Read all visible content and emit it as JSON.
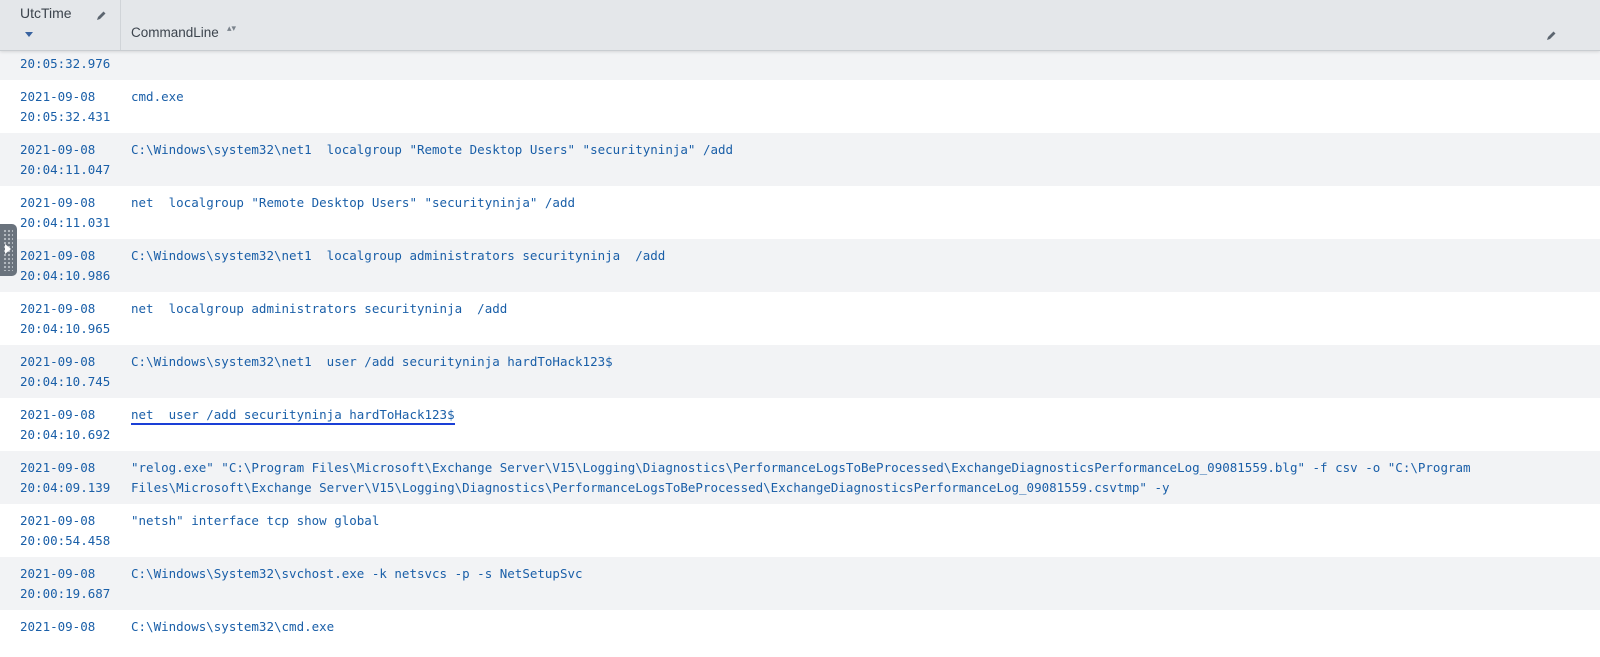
{
  "header": {
    "utc_title": "UtcTime",
    "cmd_title": "CommandLine",
    "sort_both_glyph": "▴▾"
  },
  "rows": [
    {
      "date": "",
      "time": "20:05:32.976",
      "cmd": "",
      "cmd2": ""
    },
    {
      "date": "2021-09-08",
      "time": "20:05:32.431",
      "cmd": "cmd.exe",
      "cmd2": ""
    },
    {
      "date": "2021-09-08",
      "time": "20:04:11.047",
      "cmd": "C:\\Windows\\system32\\net1  localgroup \"Remote Desktop Users\" \"securityninja\" /add",
      "cmd2": ""
    },
    {
      "date": "2021-09-08",
      "time": "20:04:11.031",
      "cmd": "net  localgroup \"Remote Desktop Users\" \"securityninja\" /add",
      "cmd2": ""
    },
    {
      "date": "2021-09-08",
      "time": "20:04:10.986",
      "cmd": "C:\\Windows\\system32\\net1  localgroup administrators securityninja  /add",
      "cmd2": ""
    },
    {
      "date": "2021-09-08",
      "time": "20:04:10.965",
      "cmd": "net  localgroup administrators securityninja  /add",
      "cmd2": ""
    },
    {
      "date": "2021-09-08",
      "time": "20:04:10.745",
      "cmd": "C:\\Windows\\system32\\net1  user /add securityninja hardToHack123$",
      "cmd2": ""
    },
    {
      "date": "2021-09-08",
      "time": "20:04:10.692",
      "cmd": "net  user /add securityninja hardToHack123$",
      "cmd2": ""
    },
    {
      "date": "2021-09-08",
      "time": "20:04:09.139",
      "cmd": "\"relog.exe\" \"C:\\Program Files\\Microsoft\\Exchange Server\\V15\\Logging\\Diagnostics\\PerformanceLogsToBeProcessed\\ExchangeDiagnosticsPerformanceLog_09081559.blg\" -f csv -o \"C:\\Program",
      "cmd2": "Files\\Microsoft\\Exchange Server\\V15\\Logging\\Diagnostics\\PerformanceLogsToBeProcessed\\ExchangeDiagnosticsPerformanceLog_09081559.csvtmp\" -y"
    },
    {
      "date": "2021-09-08",
      "time": "20:00:54.458",
      "cmd": "\"netsh\" interface tcp show global",
      "cmd2": ""
    },
    {
      "date": "2021-09-08",
      "time": "20:00:19.687",
      "cmd": "C:\\Windows\\System32\\svchost.exe -k netsvcs -p -s NetSetupSvc",
      "cmd2": ""
    },
    {
      "date": "2021-09-08",
      "time": "",
      "cmd": "C:\\Windows\\system32\\cmd.exe",
      "cmd2": ""
    }
  ],
  "colors": {
    "link": "#1a5fa8",
    "row_alt": "#f2f3f5",
    "header_bg": "#e4e7ea",
    "highlight_underline": "#1a3fd6"
  },
  "highlighted_row": 7
}
